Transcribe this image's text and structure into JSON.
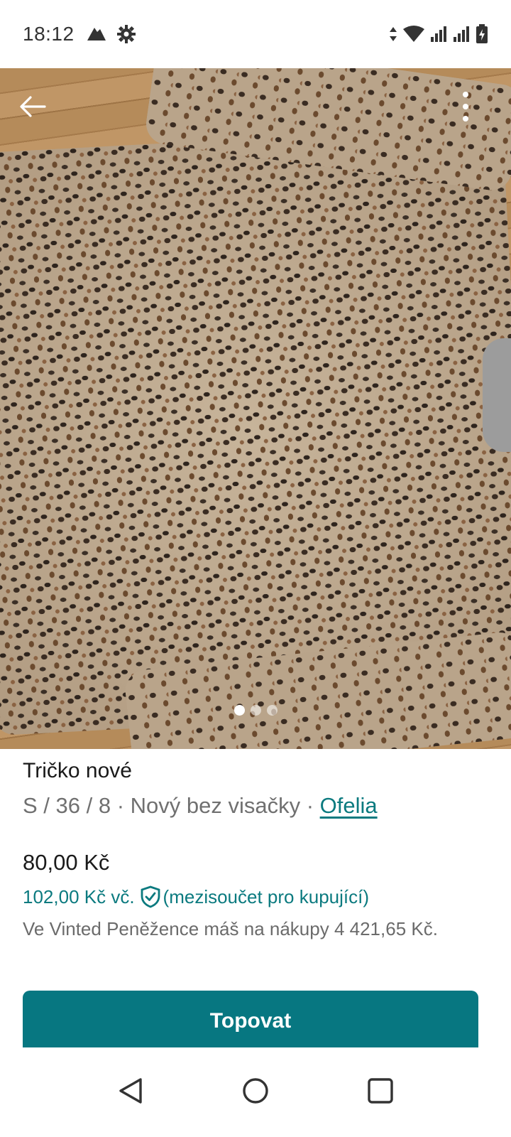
{
  "status_bar": {
    "time": "18:12",
    "icons": [
      "cloud-alert-icon",
      "gear-icon",
      "data-arrows-icon",
      "wifi-icon",
      "signal-icon",
      "signal-2-icon",
      "battery-charging-icon"
    ]
  },
  "photo": {
    "back_icon": "arrow-left-icon",
    "more_icon": "more-vertical-icon",
    "page_count": 3,
    "active_page": 1
  },
  "item": {
    "title": "Tričko nové",
    "size_condition": "S / 36 / 8 · Nový bez visačky · ",
    "brand": "Ofelia",
    "price": "80,00 Kč",
    "price_with_fee": "102,00 Kč  vč.",
    "fee_note": "(mezisoučet pro kupující)",
    "wallet_note": "Ve Vinted Peněžence máš na nákupy 4 421,65 Kč."
  },
  "actions": {
    "bump_label": "Topovat"
  },
  "nav": {
    "back": "nav-back-icon",
    "home": "nav-home-icon",
    "recents": "nav-recents-icon"
  },
  "colors": {
    "accent": "#077781",
    "link": "#0b7a7f",
    "muted_text": "#707070"
  }
}
